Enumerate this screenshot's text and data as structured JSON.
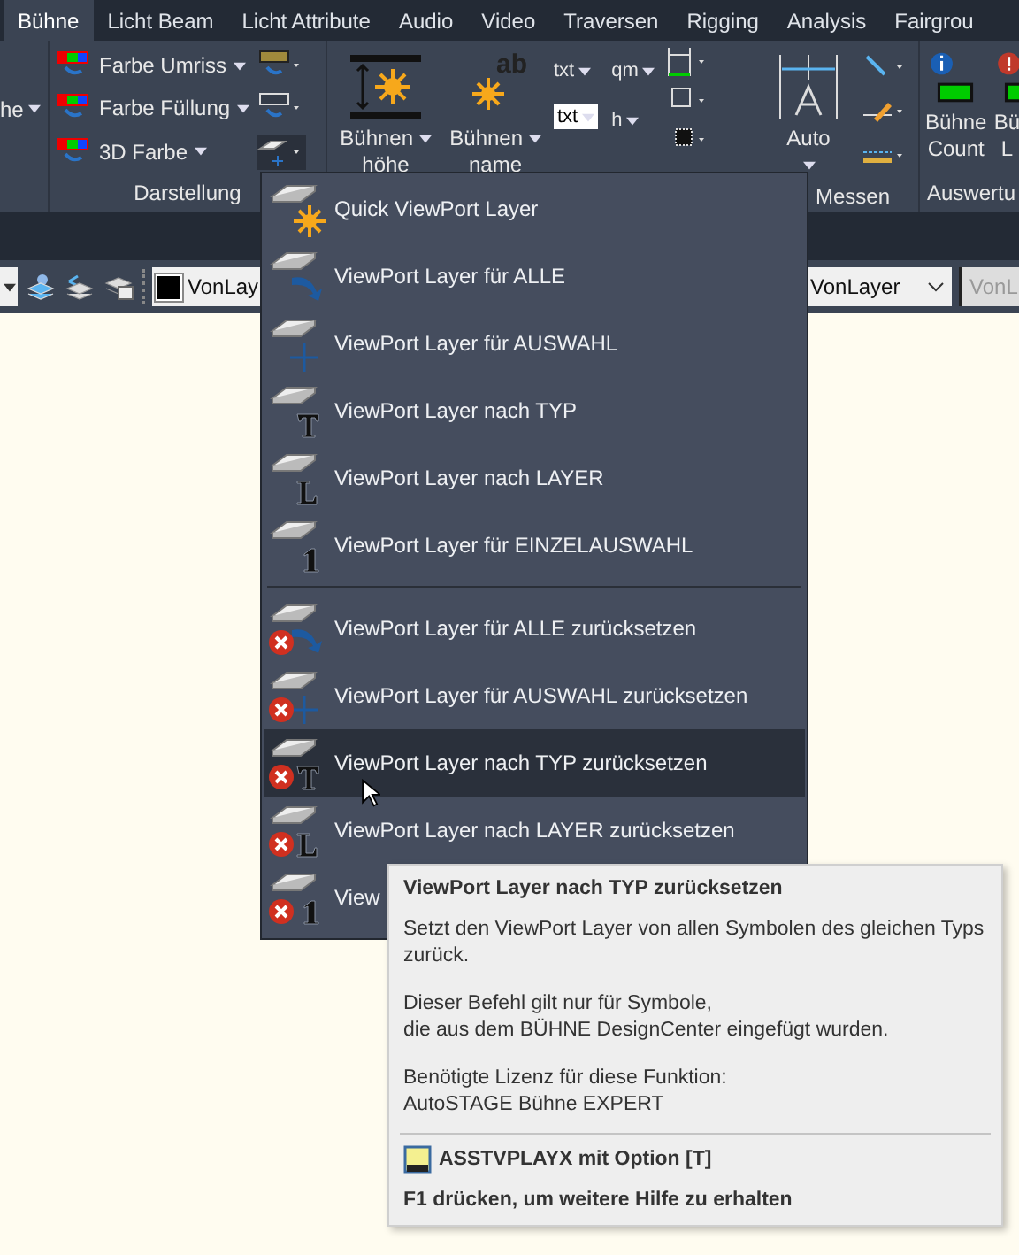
{
  "ribbon": {
    "tabs": [
      {
        "label": "Bühne",
        "selected": true
      },
      {
        "label": "Licht Beam",
        "selected": false
      },
      {
        "label": "Licht Attribute",
        "selected": false
      },
      {
        "label": "Audio",
        "selected": false
      },
      {
        "label": "Video",
        "selected": false
      },
      {
        "label": "Traversen",
        "selected": false
      },
      {
        "label": "Rigging",
        "selected": false
      },
      {
        "label": "Analysis",
        "selected": false
      },
      {
        "label": "Fairgrou",
        "selected": false
      }
    ],
    "panels": [
      {
        "kind": "edge",
        "label": "he"
      },
      {
        "kind": "colors",
        "title": "Darstellung",
        "commands": [
          {
            "label": "Farbe Umriss"
          },
          {
            "label": "Farbe Füllung"
          },
          {
            "label": "3D Farbe"
          }
        ]
      },
      {
        "kind": "tools",
        "large": [
          {
            "lines": [
              "Bühnen",
              "höhe"
            ]
          },
          {
            "lines": [
              "Bühnen",
              "name"
            ],
            "icon_text": "ab"
          }
        ],
        "small": [
          {
            "label": "txt"
          },
          {
            "label": "qm"
          },
          {
            "label": "txt"
          },
          {
            "label": "h"
          }
        ]
      },
      {
        "kind": "measure",
        "title": "Messen",
        "large": [
          {
            "label": "Auto"
          }
        ]
      },
      {
        "kind": "stats",
        "title": "Auswertu",
        "large": [
          {
            "lines": [
              "Bühne",
              "Count"
            ]
          },
          {
            "lines": [
              "Bü",
              "L"
            ]
          }
        ]
      }
    ]
  },
  "toolbar": {
    "left_combo": "VonLay",
    "right_combo": "VonLayer",
    "disabled_combo": "VonL"
  },
  "menu": {
    "sections": [
      [
        {
          "label": "Quick ViewPort Layer",
          "kind": "sun",
          "reset": false,
          "selected": false
        },
        {
          "label": "ViewPort Layer für ALLE",
          "kind": "arrow",
          "reset": false,
          "selected": false
        },
        {
          "label": "ViewPort Layer für AUSWAHL",
          "kind": "pick",
          "reset": false,
          "selected": false
        },
        {
          "label": "ViewPort Layer nach TYP",
          "kind": "type",
          "reset": false,
          "selected": false
        },
        {
          "label": "ViewPort Layer nach LAYER",
          "kind": "layer",
          "reset": false,
          "selected": false
        },
        {
          "label": "ViewPort Layer für EINZELAUSWAHL",
          "kind": "single",
          "reset": false,
          "selected": false
        }
      ],
      [
        {
          "label": "ViewPort Layer für ALLE zurücksetzen",
          "kind": "arrow",
          "reset": true,
          "selected": false
        },
        {
          "label": "ViewPort Layer für AUSWAHL zurücksetzen",
          "kind": "pick",
          "reset": true,
          "selected": false
        },
        {
          "label": "ViewPort Layer nach TYP zurücksetzen",
          "kind": "type",
          "reset": true,
          "selected": true
        },
        {
          "label": "ViewPort Layer nach LAYER zurücksetzen",
          "kind": "layer",
          "reset": true,
          "selected": false
        },
        {
          "label": "View",
          "kind": "single",
          "reset": true,
          "selected": false
        }
      ]
    ]
  },
  "tooltip": {
    "title": "ViewPort Layer nach TYP zurücksetzen",
    "paragraphs": [
      [
        "Setzt den ViewPort Layer von allen Symbolen des gleichen Typs",
        "zurück."
      ],
      [
        "Dieser Befehl gilt nur für Symbole,",
        "die aus dem BÜHNE DesignCenter eingefügt wurden."
      ],
      [
        "Benötigte Lizenz für diese Funktion:",
        "AutoSTAGE Bühne EXPERT"
      ]
    ],
    "command": "ASSTVPLAYX mit Option [T]",
    "help": "F1 drücken, um weitere Hilfe zu erhalten"
  }
}
